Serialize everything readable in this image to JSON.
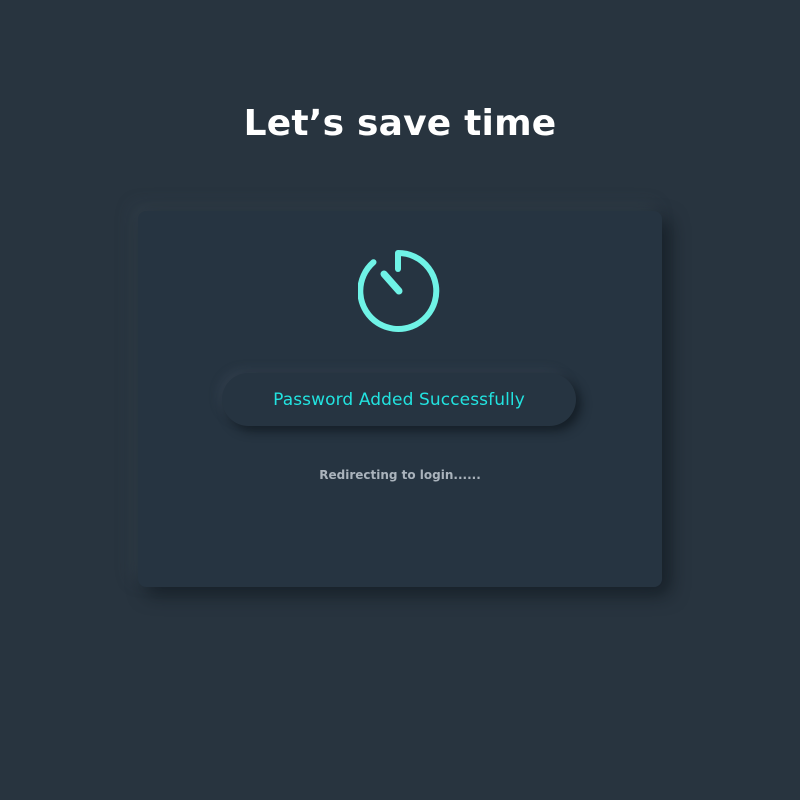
{
  "page": {
    "title": "Let’s save time"
  },
  "card": {
    "icon": "timer-icon",
    "status_message": "Password Added Successfully",
    "redirect_message": "Redirecting to login......"
  },
  "colors": {
    "background": "#28343f",
    "card": "#263441",
    "accent": "#6ff3e6",
    "status_text": "#22e3e0",
    "muted_text": "#aab3bc"
  }
}
